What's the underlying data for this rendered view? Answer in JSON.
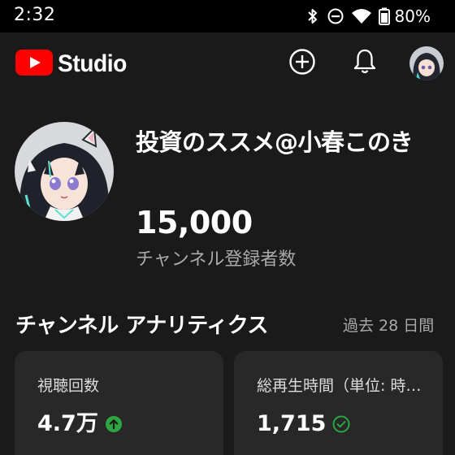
{
  "status_bar": {
    "time": "2:32",
    "battery": "80%",
    "icons": [
      "bluetooth-icon",
      "do-not-disturb-icon",
      "wifi-icon",
      "battery-icon"
    ]
  },
  "header": {
    "logo_text": "Studio",
    "logo_color": "#ff0000",
    "create_icon": "plus-circle-icon",
    "notifications_icon": "bell-icon"
  },
  "channel": {
    "name": "投資のススメ@小春このき",
    "subscriber_count": "15,000",
    "subscriber_label": "チャンネル登録者数"
  },
  "analytics": {
    "title": "チャンネル アナリティクス",
    "period": "過去 28 日間",
    "cards": [
      {
        "label": "視聴回数",
        "value": "4.7万",
        "trend_icon": "arrow-up-circle-icon",
        "trend_color": "#2ba640"
      },
      {
        "label": "総再生時間（単位: 時間）",
        "value": "1,715",
        "trend_icon": "check-circle-icon",
        "trend_color": "#2ba640"
      }
    ]
  }
}
